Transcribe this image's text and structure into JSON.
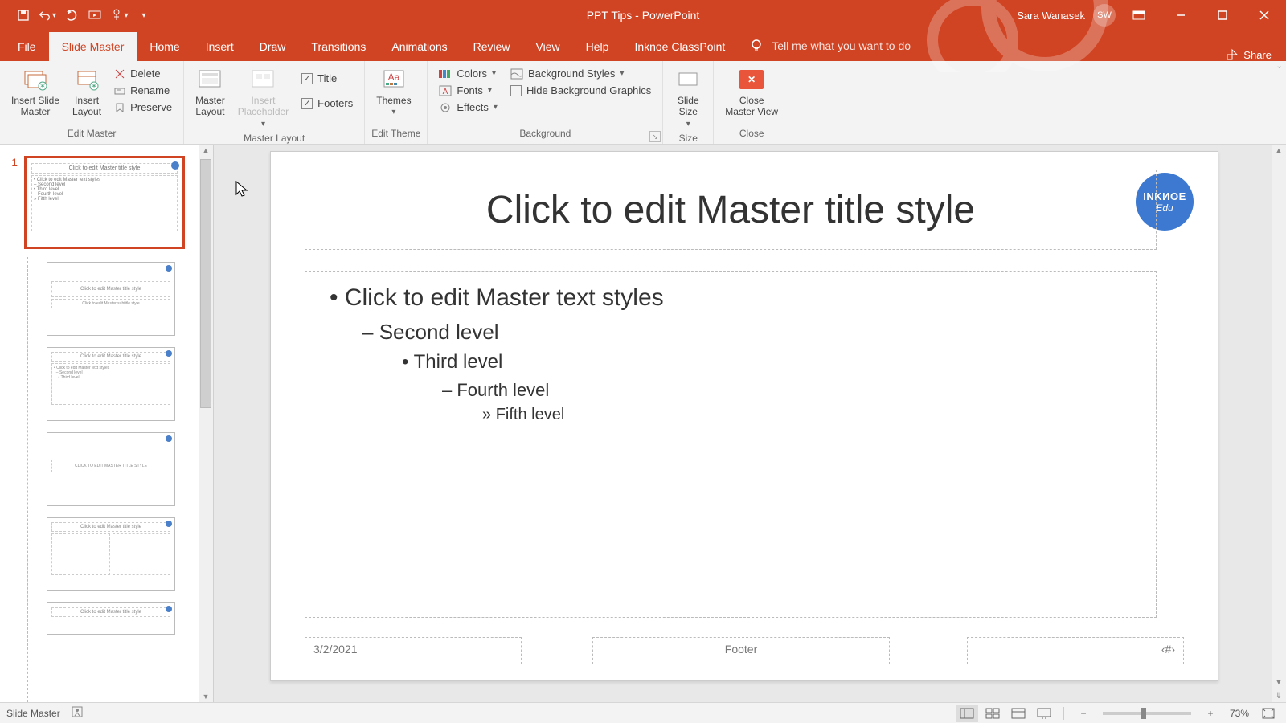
{
  "titlebar": {
    "app_title": "PPT Tips  -  PowerPoint",
    "user_name": "Sara Wanasek",
    "user_initials": "SW"
  },
  "tabs": {
    "file": "File",
    "slide_master": "Slide Master",
    "home": "Home",
    "insert": "Insert",
    "draw": "Draw",
    "transitions": "Transitions",
    "animations": "Animations",
    "review": "Review",
    "view": "View",
    "help": "Help",
    "inknoe": "Inknoe ClassPoint",
    "tellme_placeholder": "Tell me what you want to do",
    "share": "Share"
  },
  "ribbon": {
    "insert_slide_master": "Insert Slide\nMaster",
    "insert_layout": "Insert\nLayout",
    "delete": "Delete",
    "rename": "Rename",
    "preserve": "Preserve",
    "edit_master_group": "Edit Master",
    "master_layout": "Master\nLayout",
    "insert_placeholder": "Insert\nPlaceholder",
    "title_cb": "Title",
    "footers_cb": "Footers",
    "master_layout_group": "Master Layout",
    "themes": "Themes",
    "edit_theme_group": "Edit Theme",
    "colors": "Colors",
    "fonts": "Fonts",
    "effects": "Effects",
    "bg_styles": "Background Styles",
    "hide_bg": "Hide Background Graphics",
    "background_group": "Background",
    "slide_size": "Slide\nSize",
    "size_group": "Size",
    "close_master": "Close\nMaster View",
    "close_group": "Close"
  },
  "slide": {
    "title": "Click to edit Master title style",
    "body_l1": "Click to edit Master text styles",
    "body_l2": "Second level",
    "body_l3": "Third level",
    "body_l4": "Fourth level",
    "body_l5": "Fifth level",
    "date": "3/2/2021",
    "footer": "Footer",
    "slidenum": "‹#›",
    "logo_top": "INKИOE",
    "logo_bottom": "Edu"
  },
  "thumbs": {
    "index": "1",
    "master_title": "Click to edit Master title style",
    "master_body": "• Click to edit Master text styles\n   – Second level\n      • Third level\n         – Fourth level\n            » Fifth level",
    "layout_title": "Click to edit Master title style",
    "layout3_title": "CLICK TO EDIT MASTER TITLE STYLE"
  },
  "status": {
    "view_label": "Slide Master",
    "zoom": "73%"
  }
}
